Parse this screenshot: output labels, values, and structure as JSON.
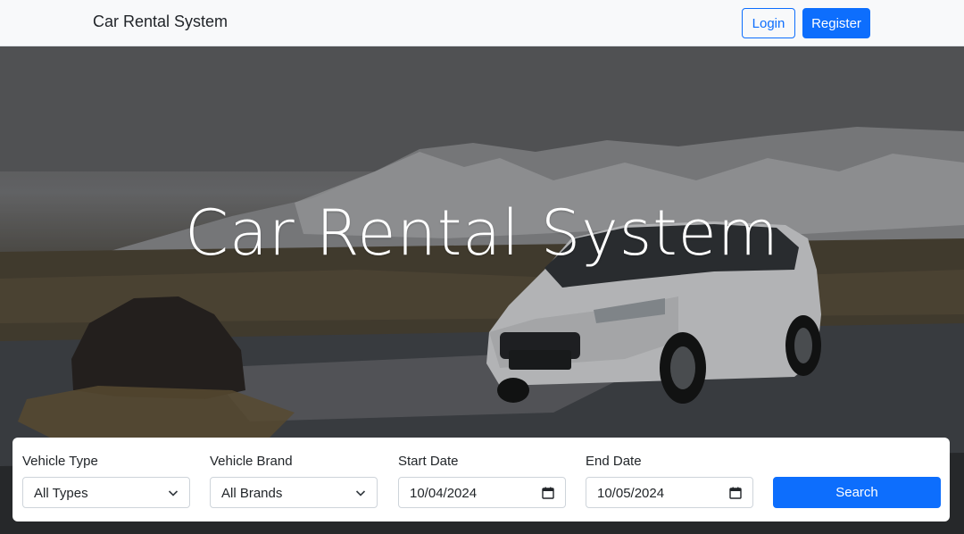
{
  "navbar": {
    "brand": "Car Rental System",
    "login_label": "Login",
    "register_label": "Register"
  },
  "hero": {
    "title": "Car Rental System"
  },
  "search": {
    "vehicle_type": {
      "label": "Vehicle Type",
      "value": "All Types"
    },
    "vehicle_brand": {
      "label": "Vehicle Brand",
      "value": "All Brands"
    },
    "start_date": {
      "label": "Start Date",
      "value": "10/04/2024"
    },
    "end_date": {
      "label": "End Date",
      "value": "10/05/2024"
    },
    "search_label": "Search"
  },
  "colors": {
    "primary": "#0d6efd",
    "navbar_bg": "#f8f9fa"
  }
}
